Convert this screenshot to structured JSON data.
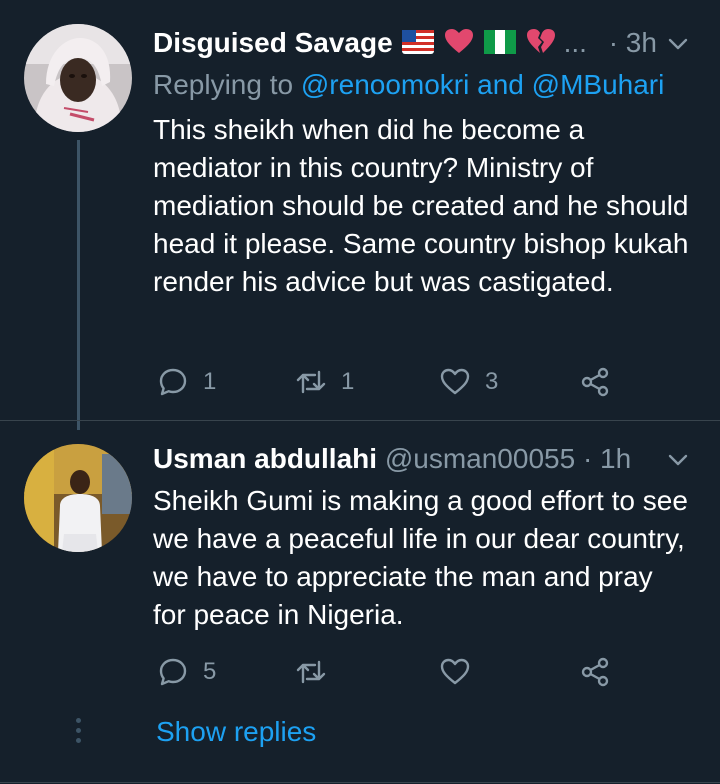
{
  "tweets": [
    {
      "name": "Disguised Savage",
      "emoji_names": [
        "us-flag-icon",
        "heart-icon",
        "ng-flag-icon",
        "broken-heart-icon"
      ],
      "ellipsis": "...",
      "handle": "",
      "time": "· 3h",
      "replying_prefix": "Replying to",
      "replying_user1": "@renoomokri",
      "replying_and": "and",
      "replying_user2": "@MBuhari",
      "text": "This sheikh when did he become a mediator in this country? Ministry of mediation should be created and he should head it please. Same country bishop kukah render his advice but was castigated.",
      "reply_count": "1",
      "retweet_count": "1",
      "like_count": "3"
    },
    {
      "name": "Usman abdullahi",
      "handle": "@usman00055",
      "time": "· 1h",
      "text": "Sheikh Gumi is making a good effort to see we have a peaceful life in our dear country, we have to appreciate the man and pray for peace in Nigeria.",
      "reply_count": "5",
      "retweet_count": "",
      "like_count": ""
    }
  ],
  "show_replies": "Show replies",
  "colors": {
    "background": "#15202b",
    "secondary_text": "#8899a6",
    "accent": "#1da1f2",
    "thread_line": "#3d5466"
  }
}
